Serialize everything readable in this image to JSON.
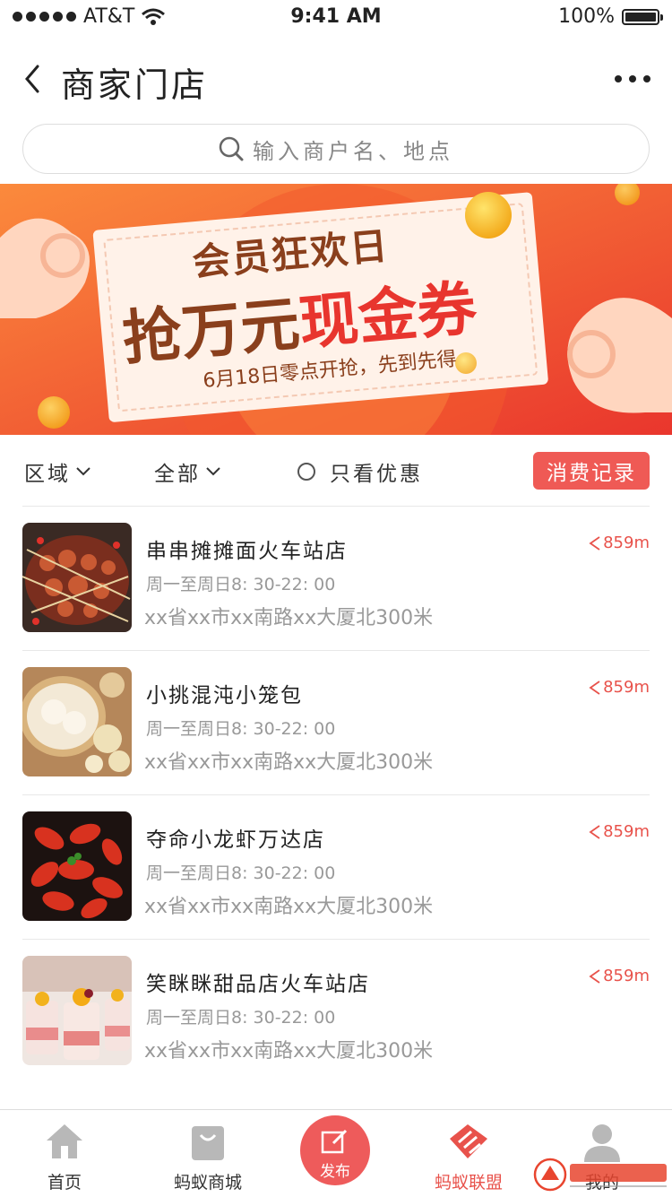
{
  "status_bar": {
    "carrier": "AT&T",
    "time": "9:41 AM",
    "battery": "100%"
  },
  "header": {
    "title": "商家门店"
  },
  "search": {
    "placeholder": "输入商户名、地点"
  },
  "banner": {
    "line1": "会员狂欢日",
    "line2a": "抢万元",
    "line2b": "现金券",
    "line3": "6月18日零点开抢，先到先得"
  },
  "filters": {
    "region": "区域",
    "category": "全部",
    "discount_only": "只看优惠",
    "record_button": "消费记录"
  },
  "stores": [
    {
      "name": "串串摊摊面火车站店",
      "hours": "周一至周日8:  30-22:  00",
      "address": "xx省xx市xx南路xx大厦北300米",
      "distance": "859m",
      "image": "skewers-food-photo"
    },
    {
      "name": "小挑混沌小笼包",
      "hours": "周一至周日8:  30-22:  00",
      "address": "xx省xx市xx南路xx大厦北300米",
      "distance": "859m",
      "image": "dumplings-food-photo"
    },
    {
      "name": "夺命小龙虾万达店",
      "hours": "周一至周日8:  30-22:  00",
      "address": "xx省xx市xx南路xx大厦北300米",
      "distance": "859m",
      "image": "crayfish-food-photo"
    },
    {
      "name": "笑眯眯甜品店火车站店",
      "hours": "周一至周日8:  30-22:  00",
      "address": "xx省xx市xx南路xx大厦北300米",
      "distance": "859m",
      "image": "dessert-food-photo"
    }
  ],
  "tabbar": {
    "home": "首页",
    "mall": "蚂蚁商城",
    "publish": "发布",
    "alliance": "蚂蚁联盟",
    "mine": "我的"
  },
  "colors": {
    "accent": "#ef5a55",
    "banner": "#f0463a",
    "text_gray": "#999999"
  }
}
